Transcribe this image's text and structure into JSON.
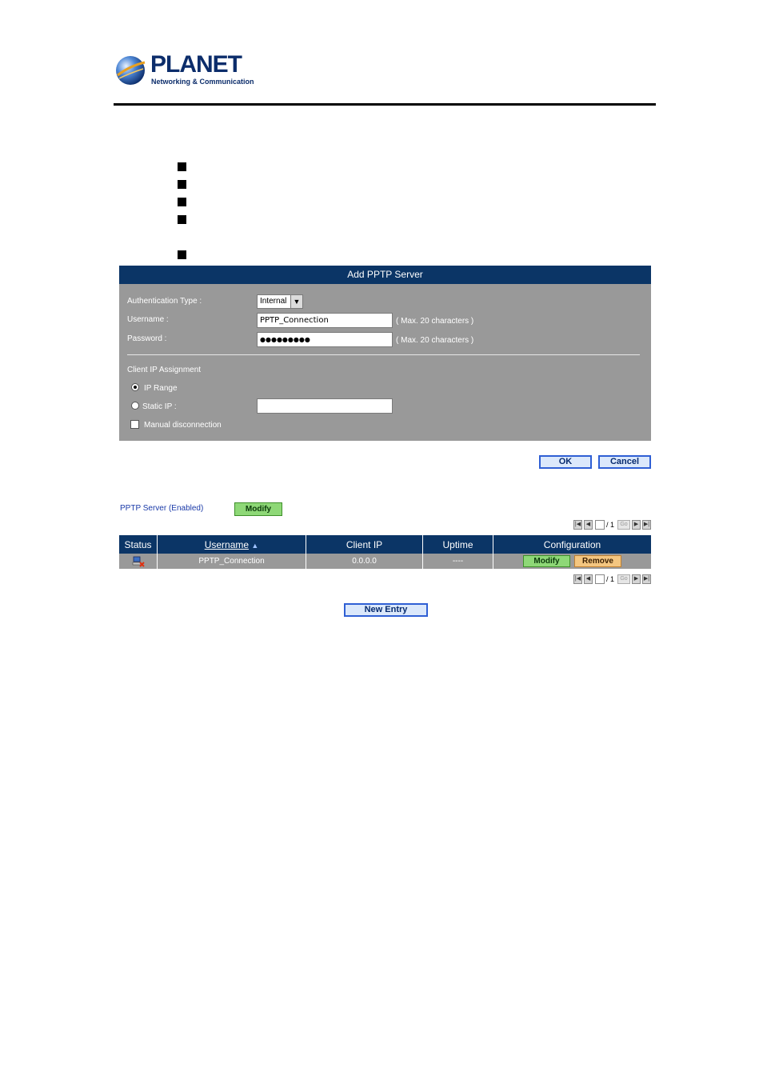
{
  "header": {
    "logo_word": "PLANET",
    "logo_tagline": "Networking & Communication"
  },
  "add_panel": {
    "title": "Add PPTP Server",
    "auth_type_label": "Authentication Type :",
    "auth_type_value": "Internal",
    "username_label": "Username :",
    "username_value": "PPTP_Connection",
    "username_hint": "( Max. 20 characters )",
    "password_label": "Password :",
    "password_value": "●●●●●●●●●",
    "password_hint": "( Max. 20 characters )",
    "client_ip_label": "Client IP Assignment",
    "ip_range_label": "IP Range",
    "static_ip_label": "Static IP :",
    "static_ip_value": "",
    "manual_disconnect_label": "Manual disconnection"
  },
  "form_buttons": {
    "ok": "OK",
    "cancel": "Cancel"
  },
  "server_status": {
    "text": "PPTP Server (Enabled)",
    "modify": "Modify"
  },
  "pager": {
    "page": "1",
    "total": "/ 1",
    "go": "Go"
  },
  "table": {
    "columns": [
      "Status",
      "Username",
      "Client IP",
      "Uptime",
      "Configuration"
    ],
    "rows": [
      {
        "username": "PPTP_Connection",
        "client_ip": "0.0.0.0",
        "uptime": "----",
        "modify": "Modify",
        "remove": "Remove"
      }
    ]
  },
  "new_entry": "New Entry",
  "colors": {
    "header_navy": "#0b3566",
    "panel_gray": "#999999",
    "button_green": "#8ed877",
    "button_orange": "#f4c680",
    "link_blue": "#1a3aa8"
  }
}
